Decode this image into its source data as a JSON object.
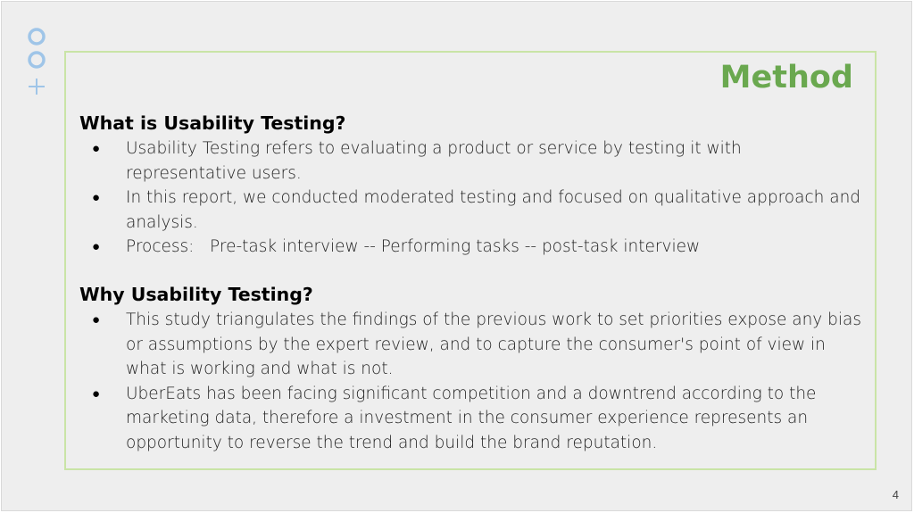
{
  "slide": {
    "title": "Method",
    "page_number": "4",
    "accent_color": "#6aa84f",
    "border_color": "#c9e4a6",
    "decoration_color": "#9fc5e8"
  },
  "sections": [
    {
      "heading": "What is Usability Testing?",
      "bullets": [
        "Usability Testing refers to evaluating a product or service by testing it with representative users.",
        "In this report, we conducted moderated testing and focused on qualitative approach and analysis.",
        "Process:   Pre-task interview -- Performing tasks -- post-task interview"
      ]
    },
    {
      "heading": "Why Usability Testing?",
      "bullets": [
        "This study triangulates the findings of the previous work to set priorities expose any bias or assumptions by the expert review, and to capture the consumer's point of view in what is working and what is not.",
        "UberEats has been facing significant competition and a downtrend according to the marketing data, therefore a investment in the consumer experience represents an opportunity to reverse the trend and build the brand reputation."
      ]
    }
  ]
}
